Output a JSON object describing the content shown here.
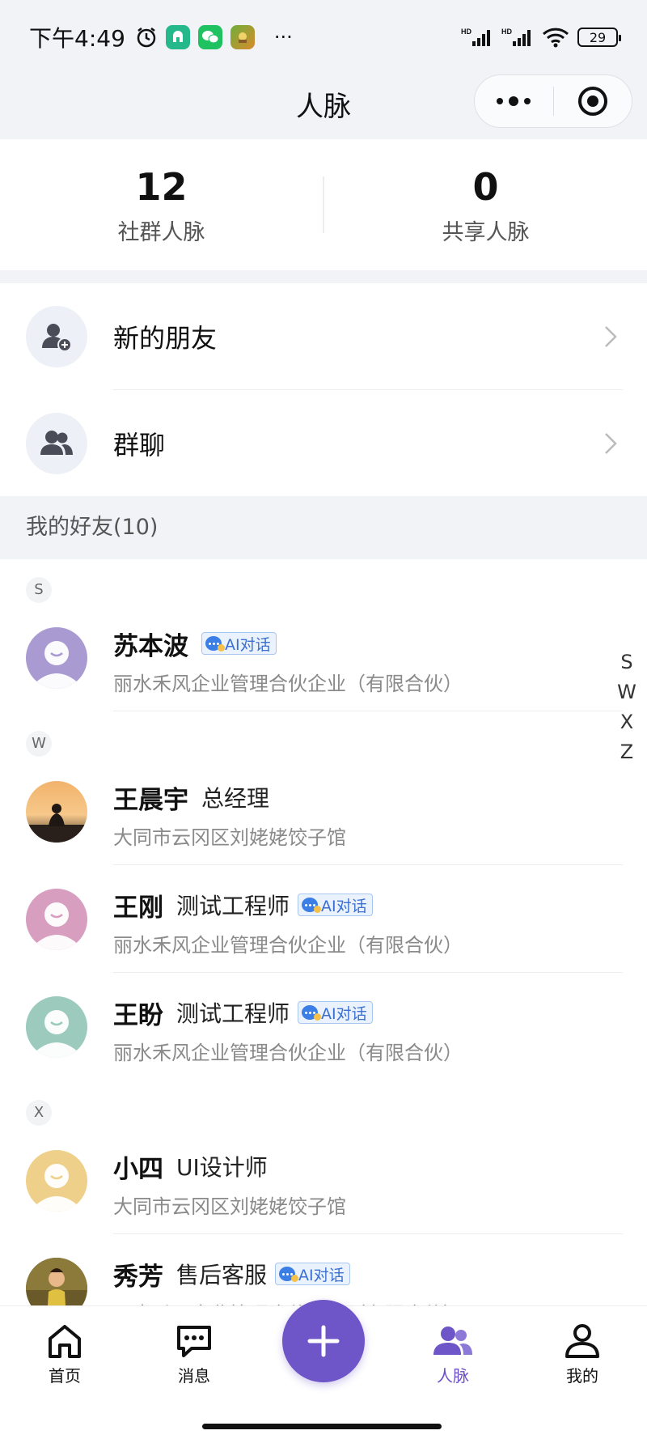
{
  "status_bar": {
    "time": "下午4:49",
    "battery": "29",
    "more": "···"
  },
  "header": {
    "title": "人脉"
  },
  "stats": [
    {
      "value": "12",
      "label": "社群人脉"
    },
    {
      "value": "0",
      "label": "共享人脉"
    }
  ],
  "menu": [
    {
      "label": "新的朋友",
      "icon": "add-user-icon"
    },
    {
      "label": "群聊",
      "icon": "group-icon"
    }
  ],
  "friends_header": "我的好友(10)",
  "ai_badge_label": "AI对话",
  "groups": [
    "S",
    "W",
    "X"
  ],
  "friends": [
    {
      "name": "苏本波",
      "title": "",
      "company": "丽水禾风企业管理合伙企业（有限合伙）",
      "ai": true,
      "avatar_color": "#a99bd2"
    },
    {
      "name": "王晨宇",
      "title": "总经理",
      "company": "大同市云冈区刘姥姥饺子馆",
      "ai": false,
      "avatar_color": "photo-sunset"
    },
    {
      "name": "王刚",
      "title": "测试工程师",
      "company": "丽水禾风企业管理合伙企业（有限合伙）",
      "ai": true,
      "avatar_color": "#d89ec0"
    },
    {
      "name": "王盼",
      "title": "测试工程师",
      "company": "丽水禾风企业管理合伙企业（有限合伙）",
      "ai": true,
      "avatar_color": "#9ccbbd"
    },
    {
      "name": "小四",
      "title": "UI设计师",
      "company": "大同市云冈区刘姥姥饺子馆",
      "ai": false,
      "avatar_color": "#efd08a"
    },
    {
      "name": "秀芳",
      "title": "售后客服",
      "company": "丽水禾风企业管理合伙企业（有限合伙）",
      "ai": true,
      "avatar_color": "photo-portrait"
    }
  ],
  "index_letters": [
    "S",
    "W",
    "X",
    "Z"
  ],
  "tabbar": [
    {
      "label": "首页",
      "icon": "home-icon",
      "active": false
    },
    {
      "label": "消息",
      "icon": "message-icon",
      "active": false
    },
    {
      "label": "人脉",
      "icon": "contacts-icon",
      "active": true
    },
    {
      "label": "我的",
      "icon": "profile-icon",
      "active": false
    }
  ],
  "colors": {
    "accent": "#6e55c8",
    "badge_blue": "#3b6fd0",
    "page_bg": "#f2f3f7"
  }
}
